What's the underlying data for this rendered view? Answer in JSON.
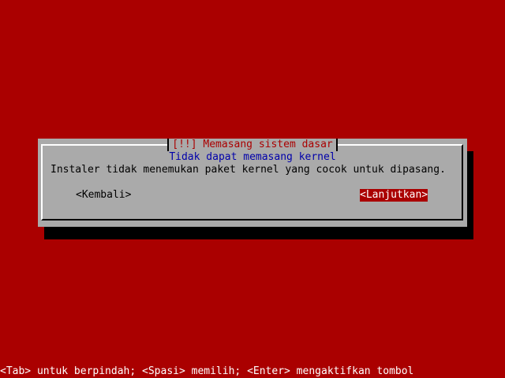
{
  "dialog": {
    "title": "[!!] Memasang sistem dasar",
    "subtitle": "Tidak dapat memasang kernel",
    "message": "Instaler tidak menemukan paket kernel yang cocok untuk dipasang.",
    "back_label": "<Kembali>",
    "continue_label": "<Lanjutkan>"
  },
  "footer": {
    "help_text": "<Tab> untuk berpindah; <Spasi> memilih; <Enter> mengaktifkan tombol"
  },
  "colors": {
    "background": "#aa0000",
    "dialog_background": "#aaaaaa",
    "title_text": "#aa0000",
    "subtitle_text": "#0000aa",
    "selected_button_background": "#aa0000",
    "selected_button_text": "#ffffff"
  }
}
